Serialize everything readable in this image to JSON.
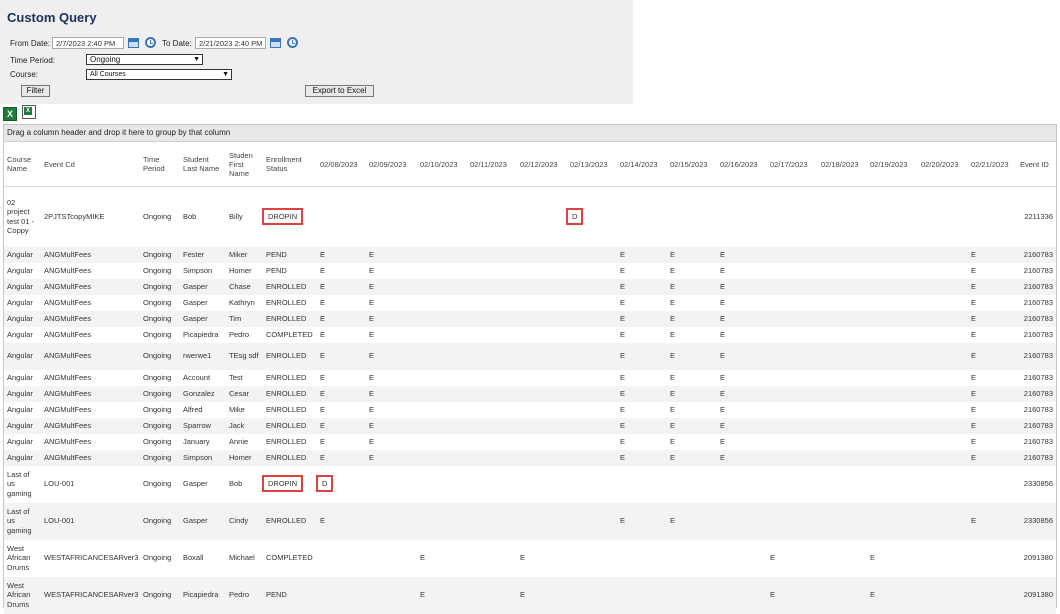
{
  "title": "Custom Query",
  "filters": {
    "from_label": "From Date:",
    "from_value": "2/7/2023 2:40 PM",
    "to_label": "To Date:",
    "to_value": "2/21/2023 2:40 PM",
    "time_period_label": "Time Period:",
    "time_period_value": "Ongoing",
    "course_label": "Course:",
    "course_value": "All Courses",
    "filter_button": "Filter",
    "export_button": "Export to Excel"
  },
  "grid": {
    "group_hint": "Drag a column header and drop it here to group by that column",
    "headers": [
      "Course Name",
      "Event Cd",
      "Time Period",
      "Student Last Name",
      "Studen First Name",
      "Enrollment Status",
      "02/08/2023",
      "02/09/2023",
      "02/10/2023",
      "02/11/2023",
      "02/12/2023",
      "02/13/2023",
      "02/14/2023",
      "02/15/2023",
      "02/16/2023",
      "02/17/2023",
      "02/18/2023",
      "02/19/2023",
      "02/20/2023",
      "02/21/2023",
      "Event ID"
    ],
    "rows": [
      {
        "course": "02 project test 01 - Coppy",
        "event": "2PJTSTcopyMIKE",
        "period": "Ongoing",
        "last": "Bob",
        "first": "Billy",
        "status": "DROPIN",
        "days": [
          "",
          "",
          "",
          "",
          "",
          "D",
          "",
          "",
          "",
          "",
          "",
          "",
          "",
          ""
        ],
        "id": "2211336"
      },
      {
        "course": "Angular",
        "event": "ANGMultFees",
        "period": "Ongoing",
        "last": "Fester",
        "first": "Miker",
        "status": "PEND",
        "days": [
          "E",
          "E",
          "",
          "",
          "",
          "",
          "E",
          "E",
          "E",
          "",
          "",
          "",
          "",
          "E"
        ],
        "id": "2160783"
      },
      {
        "course": "Angular",
        "event": "ANGMultFees",
        "period": "Ongoing",
        "last": "Simpson",
        "first": "Homer",
        "status": "PEND",
        "days": [
          "E",
          "E",
          "",
          "",
          "",
          "",
          "E",
          "E",
          "E",
          "",
          "",
          "",
          "",
          "E"
        ],
        "id": "2160783"
      },
      {
        "course": "Angular",
        "event": "ANGMultFees",
        "period": "Ongoing",
        "last": "Gasper",
        "first": "Chase",
        "status": "ENROLLED",
        "days": [
          "E",
          "E",
          "",
          "",
          "",
          "",
          "E",
          "E",
          "E",
          "",
          "",
          "",
          "",
          "E"
        ],
        "id": "2160783"
      },
      {
        "course": "Angular",
        "event": "ANGMultFees",
        "period": "Ongoing",
        "last": "Gasper",
        "first": "Kathryn",
        "status": "ENROLLED",
        "days": [
          "E",
          "E",
          "",
          "",
          "",
          "",
          "E",
          "E",
          "E",
          "",
          "",
          "",
          "",
          "E"
        ],
        "id": "2160783"
      },
      {
        "course": "Angular",
        "event": "ANGMultFees",
        "period": "Ongoing",
        "last": "Gasper",
        "first": "Tim",
        "status": "ENROLLED",
        "days": [
          "E",
          "E",
          "",
          "",
          "",
          "",
          "E",
          "E",
          "E",
          "",
          "",
          "",
          "",
          "E"
        ],
        "id": "2160783"
      },
      {
        "course": "Angular",
        "event": "ANGMultFees",
        "period": "Ongoing",
        "last": "Picapiedra",
        "first": "Pedro",
        "status": "COMPLETED",
        "days": [
          "E",
          "E",
          "",
          "",
          "",
          "",
          "E",
          "E",
          "E",
          "",
          "",
          "",
          "",
          "E"
        ],
        "id": "2160783"
      },
      {
        "course": "Angular",
        "event": "ANGMultFees",
        "period": "Ongoing",
        "last": "rwerwe1",
        "first": "TEsg sdf",
        "status": "ENROLLED",
        "days": [
          "E",
          "E",
          "",
          "",
          "",
          "",
          "E",
          "E",
          "E",
          "",
          "",
          "",
          "",
          "E"
        ],
        "id": "2160783"
      },
      {
        "course": "Angular",
        "event": "ANGMultFees",
        "period": "Ongoing",
        "last": "Account",
        "first": "Test",
        "status": "ENROLLED",
        "days": [
          "E",
          "E",
          "",
          "",
          "",
          "",
          "E",
          "E",
          "E",
          "",
          "",
          "",
          "",
          "E"
        ],
        "id": "2160783"
      },
      {
        "course": "Angular",
        "event": "ANGMultFees",
        "period": "Ongoing",
        "last": "Gonzalez",
        "first": "Cesar",
        "status": "ENROLLED",
        "days": [
          "E",
          "E",
          "",
          "",
          "",
          "",
          "E",
          "E",
          "E",
          "",
          "",
          "",
          "",
          "E"
        ],
        "id": "2160783"
      },
      {
        "course": "Angular",
        "event": "ANGMultFees",
        "period": "Ongoing",
        "last": "Alfred",
        "first": "Mike",
        "status": "ENROLLED",
        "days": [
          "E",
          "E",
          "",
          "",
          "",
          "",
          "E",
          "E",
          "E",
          "",
          "",
          "",
          "",
          "E"
        ],
        "id": "2160783"
      },
      {
        "course": "Angular",
        "event": "ANGMultFees",
        "period": "Ongoing",
        "last": "Sparrow",
        "first": "Jack",
        "status": "ENROLLED",
        "days": [
          "E",
          "E",
          "",
          "",
          "",
          "",
          "E",
          "E",
          "E",
          "",
          "",
          "",
          "",
          "E"
        ],
        "id": "2160783"
      },
      {
        "course": "Angular",
        "event": "ANGMultFees",
        "period": "Ongoing",
        "last": "January",
        "first": "Annie",
        "status": "ENROLLED",
        "days": [
          "E",
          "E",
          "",
          "",
          "",
          "",
          "E",
          "E",
          "E",
          "",
          "",
          "",
          "",
          "E"
        ],
        "id": "2160783"
      },
      {
        "course": "Angular",
        "event": "ANGMultFees",
        "period": "Ongoing",
        "last": "Simpson",
        "first": "Homer",
        "status": "ENROLLED",
        "days": [
          "E",
          "E",
          "",
          "",
          "",
          "",
          "E",
          "E",
          "E",
          "",
          "",
          "",
          "",
          "E"
        ],
        "id": "2160783"
      },
      {
        "course": "Last of us gaming",
        "event": "LOU-001",
        "period": "Ongoing",
        "last": "Gasper",
        "first": "Bob",
        "status": "DROPIN",
        "days": [
          "D",
          "",
          "",
          "",
          "",
          "",
          "",
          "",
          "",
          "",
          "",
          "",
          "",
          ""
        ],
        "id": "2330856"
      },
      {
        "course": "Last of us gaming",
        "event": "LOU-001",
        "period": "Ongoing",
        "last": "Gasper",
        "first": "Cindy",
        "status": "ENROLLED",
        "days": [
          "E",
          "",
          "",
          "",
          "",
          "",
          "E",
          "E",
          "",
          "",
          "",
          "",
          "",
          "E"
        ],
        "id": "2330856"
      },
      {
        "course": "West African Drums",
        "event": "WESTAFRICANCESARver3",
        "period": "Ongoing",
        "last": "Boxall",
        "first": "Michael",
        "status": "COMPLETED",
        "days": [
          "",
          "",
          "E",
          "",
          "E",
          "",
          "",
          "",
          "",
          "E",
          "",
          "E",
          "",
          ""
        ],
        "id": "2091380"
      },
      {
        "course": "West African Drums",
        "event": "WESTAFRICANCESARver3",
        "period": "Ongoing",
        "last": "Picapiedra",
        "first": "Pedro",
        "status": "PEND",
        "days": [
          "",
          "",
          "E",
          "",
          "E",
          "",
          "",
          "",
          "",
          "E",
          "",
          "E",
          "",
          ""
        ],
        "id": "2091380"
      }
    ]
  }
}
